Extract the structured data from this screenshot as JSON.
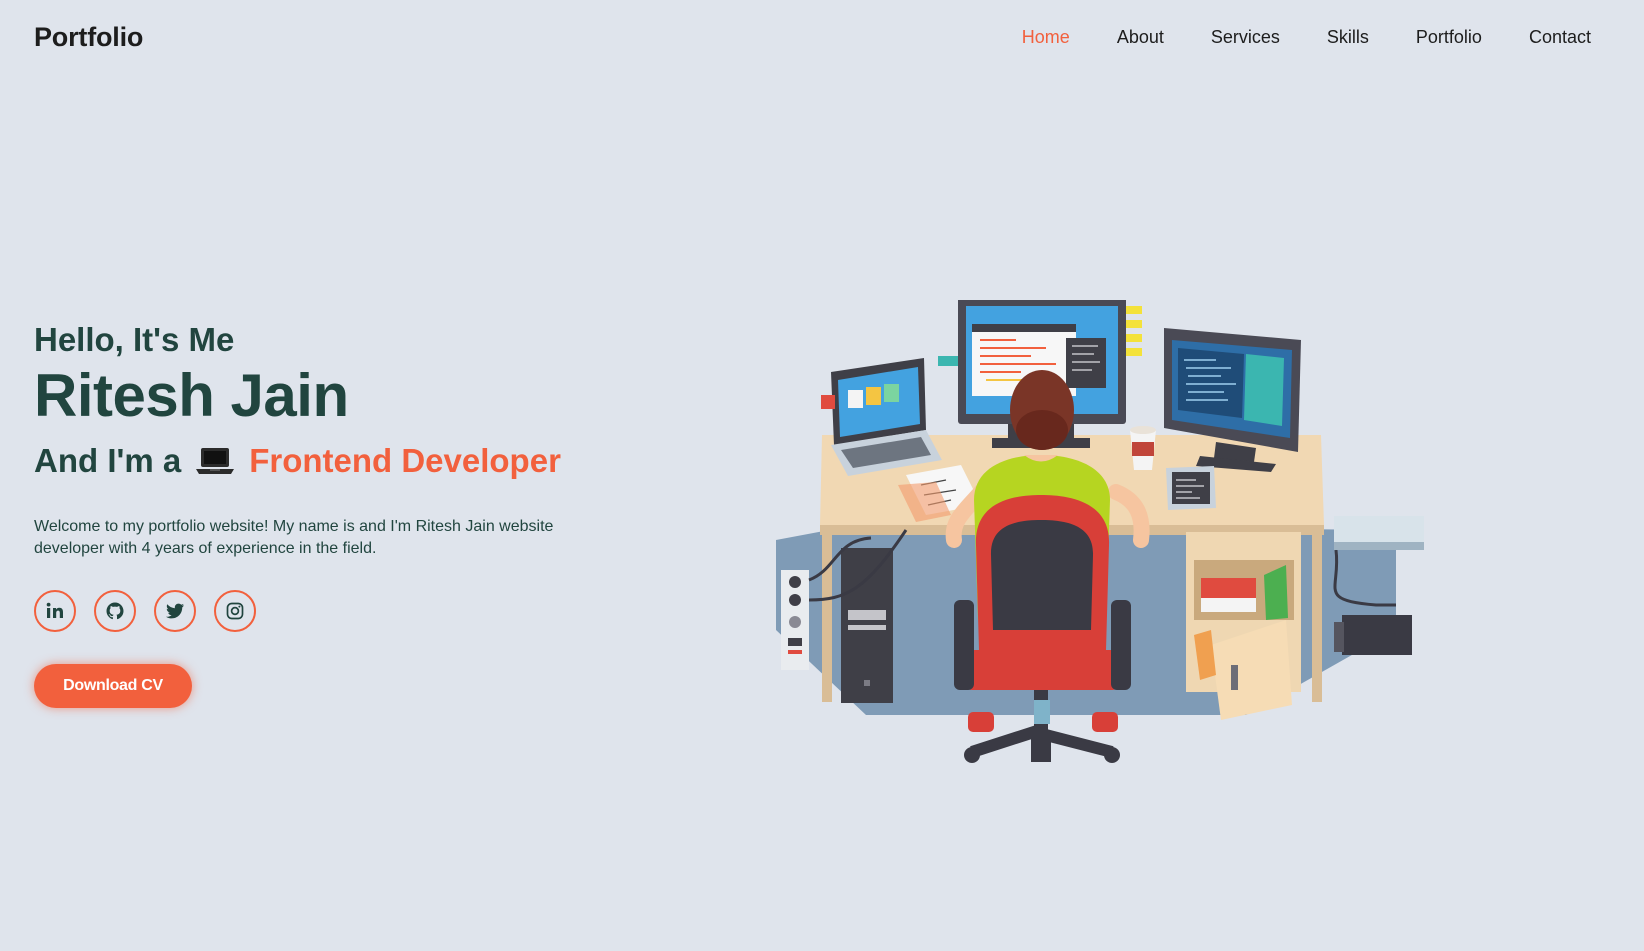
{
  "navbar": {
    "logo": "Portfolio",
    "links": [
      {
        "label": "Home",
        "active": true
      },
      {
        "label": "About",
        "active": false
      },
      {
        "label": "Services",
        "active": false
      },
      {
        "label": "Skills",
        "active": false
      },
      {
        "label": "Portfolio",
        "active": false
      },
      {
        "label": "Contact",
        "active": false
      }
    ]
  },
  "hero": {
    "greeting": "Hello, It's Me",
    "name": "Ritesh Jain",
    "role_prefix": "And I'm a",
    "role_icon": "laptop-icon",
    "role": "Frontend Developer",
    "intro": "Welcome to my portfolio website! My name is and I'm Ritesh Jain website developer with 4 years of experience in the field.",
    "socials": [
      {
        "name": "linkedin-icon"
      },
      {
        "name": "github-icon"
      },
      {
        "name": "twitter-icon"
      },
      {
        "name": "instagram-icon"
      }
    ],
    "download_label": "Download CV"
  },
  "colors": {
    "background": "#dfe4ec",
    "accent": "#f2603d",
    "heading": "#21453f"
  }
}
